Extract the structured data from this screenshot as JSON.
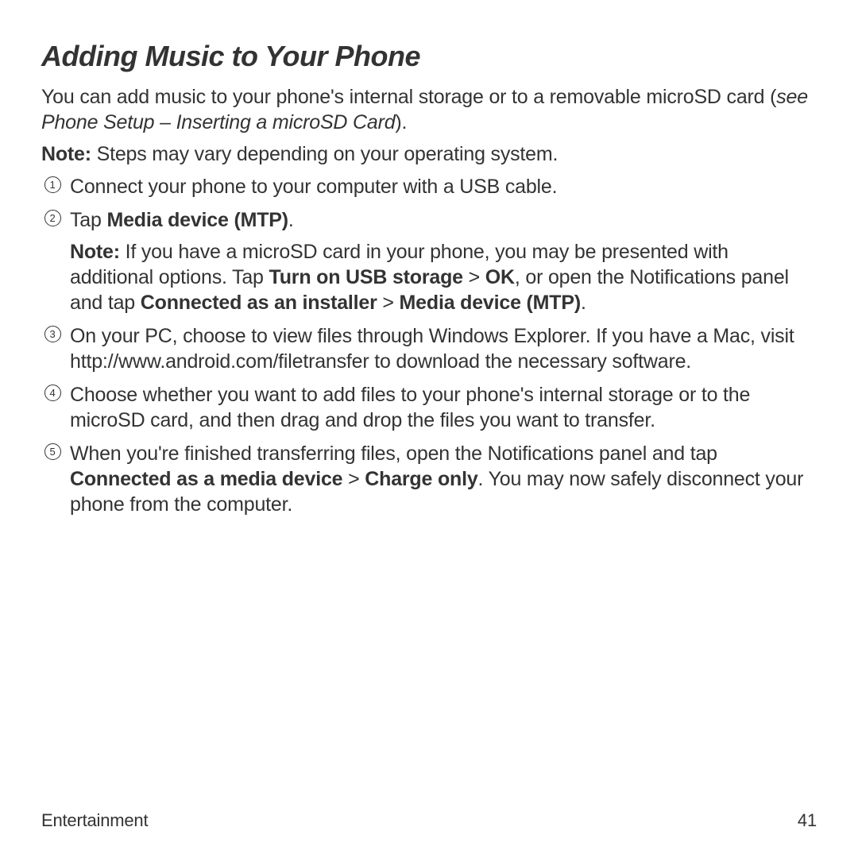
{
  "heading": "Adding Music to Your Phone",
  "intro_before": "You can add music to your phone's internal storage or to a removable microSD card (",
  "intro_italic": "see Phone Setup – Inserting a microSD Card",
  "intro_after": ").",
  "note_label": "Note:",
  "note_text": " Steps may vary depending on your operating system.",
  "steps": {
    "s1": {
      "n": "1",
      "text": "Connect your phone to your computer with a USB cable."
    },
    "s2": {
      "n": "2",
      "lead": "Tap ",
      "bold1": "Media device (MTP)",
      "tail1": ".",
      "sub_label": "Note:",
      "sub_a": " If you have a microSD card in your phone, you may be presented with additional options. Tap ",
      "sub_b1": "Turn on USB storage",
      "sub_gt1": " > ",
      "sub_b2": "OK",
      "sub_c": ", or open the Notifications panel and tap ",
      "sub_b3": "Connected as an installer",
      "sub_gt2": " > ",
      "sub_b4": "Media device (MTP)",
      "sub_d": "."
    },
    "s3": {
      "n": "3",
      "text": "On your PC, choose to view files through Windows Explorer. If you have a Mac, visit http://www.android.com/filetransfer to download the necessary software."
    },
    "s4": {
      "n": "4",
      "text": "Choose whether you want to add files to your phone's internal storage or to the microSD card, and then drag and drop the files you want to transfer."
    },
    "s5": {
      "n": "5",
      "a": "When you're finished transferring files, open the Notifications panel and tap ",
      "b1": "Connected as a media device",
      "gt": " > ",
      "b2": "Charge only",
      "c": ". You may now safely disconnect your phone from the computer."
    }
  },
  "footer": {
    "section": "Entertainment",
    "page": "41"
  }
}
